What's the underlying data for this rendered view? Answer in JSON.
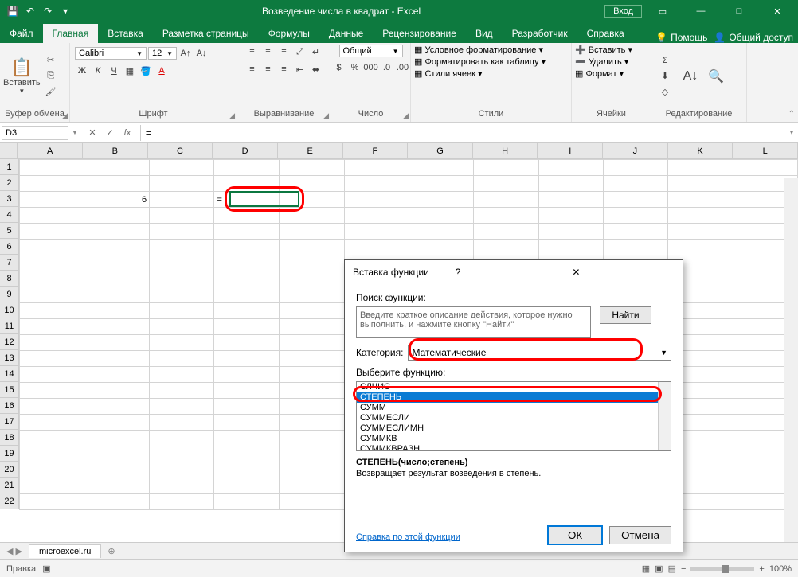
{
  "titlebar": {
    "title": "Возведение числа в квадрат - Excel",
    "login": "Вход"
  },
  "win": {
    "min": "—",
    "max": "□",
    "close": "✕"
  },
  "tabs": {
    "file": "Файл",
    "home": "Главная",
    "insert": "Вставка",
    "layout": "Разметка страницы",
    "formulas": "Формулы",
    "data": "Данные",
    "review": "Рецензирование",
    "view": "Вид",
    "developer": "Разработчик",
    "help": "Справка",
    "tellme": "Помощь",
    "share": "Общий доступ"
  },
  "ribbon": {
    "clipboard": {
      "paste": "Вставить",
      "label": "Буфер обмена"
    },
    "font": {
      "name": "Calibri",
      "size": "12",
      "b": "Ж",
      "i": "К",
      "u": "Ч",
      "label": "Шрифт"
    },
    "align": {
      "label": "Выравнивание"
    },
    "number": {
      "format": "Общий",
      "label": "Число"
    },
    "styles": {
      "cond": "Условное форматирование",
      "table": "Форматировать как таблицу",
      "cell": "Стили ячеек",
      "label": "Стили"
    },
    "cells": {
      "insert": "Вставить",
      "delete": "Удалить",
      "format": "Формат",
      "label": "Ячейки"
    },
    "editing": {
      "label": "Редактирование"
    }
  },
  "formula_bar": {
    "name_box": "D3",
    "fx": "fx",
    "content": "="
  },
  "columns": [
    "A",
    "B",
    "C",
    "D",
    "E",
    "F",
    "G",
    "H",
    "I",
    "J",
    "K",
    "L"
  ],
  "rows": [
    "1",
    "2",
    "3",
    "4",
    "5",
    "6",
    "7",
    "8",
    "9",
    "10",
    "11",
    "12",
    "13",
    "14",
    "15",
    "16",
    "17",
    "18",
    "19",
    "20",
    "21",
    "22"
  ],
  "cell_b3": "6",
  "cell_d3": "=",
  "sheet": {
    "name": "microexcel.ru",
    "add": "⊕"
  },
  "status": {
    "mode": "Правка",
    "zoom": "100%"
  },
  "dialog": {
    "title": "Вставка функции",
    "search_label": "Поиск функции:",
    "search_text": "Введите краткое описание действия, которое нужно выполнить, и нажмите кнопку \"Найти\"",
    "find": "Найти",
    "cat_label": "Категория:",
    "cat_value": "Математические",
    "list_label": "Выберите функцию:",
    "items": [
      "СЛЧИС",
      "СТЕПЕНЬ",
      "СУММ",
      "СУММЕСЛИ",
      "СУММЕСЛИМН",
      "СУММКВ",
      "СУММКВРАЗН"
    ],
    "selected_index": 1,
    "syntax": "СТЕПЕНЬ(число;степень)",
    "desc": "Возвращает результат возведения в степень.",
    "help_link": "Справка по этой функции",
    "ok": "ОК",
    "cancel": "Отмена",
    "help_q": "?",
    "close": "✕"
  }
}
